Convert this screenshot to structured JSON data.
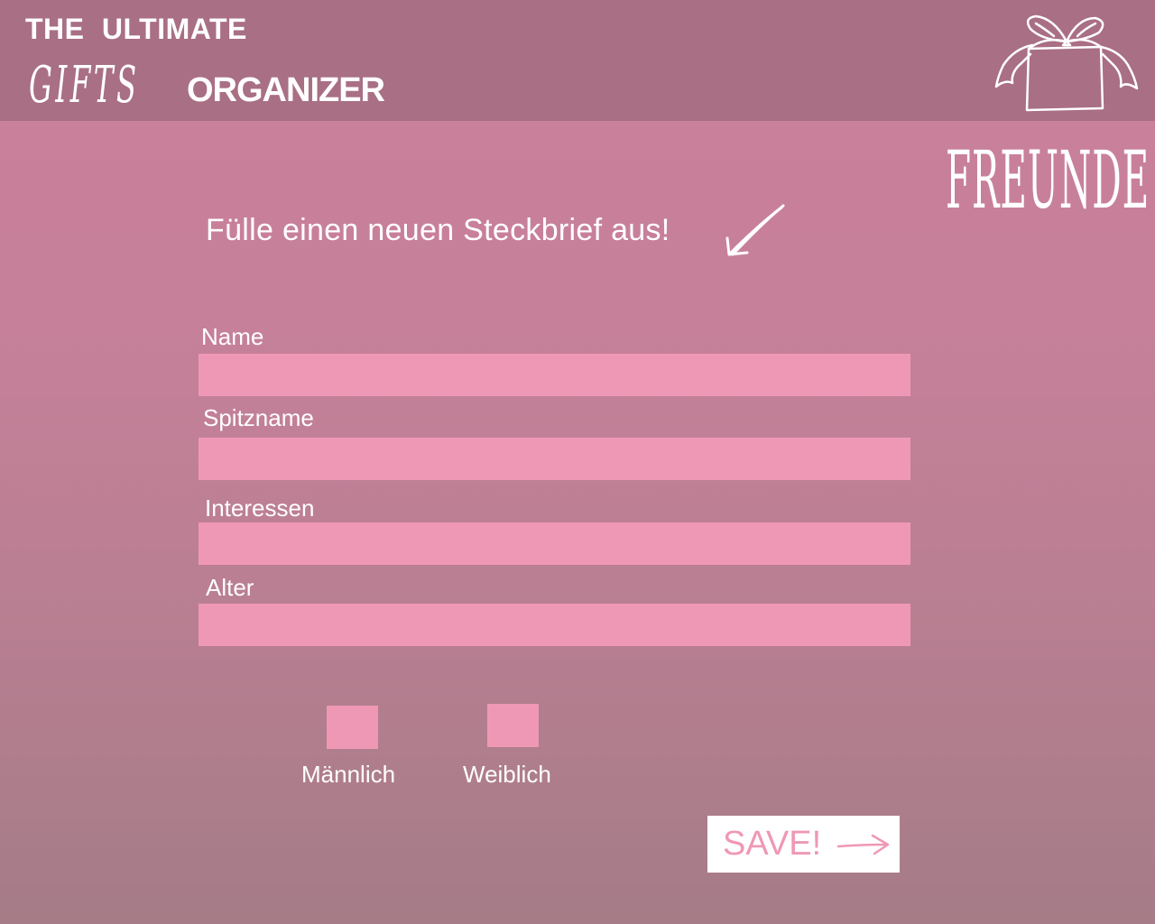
{
  "header": {
    "line1": "THE  ULTIMATE",
    "gifts": "GIFTS",
    "organizer": "ORGANIZER",
    "gift_icon": "gift-box-icon"
  },
  "section_title": "FREUNDE",
  "intro": {
    "text": "Fülle einen neuen Steckbrief aus!",
    "icon": "arrow-down-left-icon"
  },
  "form": {
    "fields": [
      {
        "label": "Name",
        "value": "",
        "placeholder": ""
      },
      {
        "label": "Spitzname",
        "value": "",
        "placeholder": ""
      },
      {
        "label": "Interessen",
        "value": "",
        "placeholder": ""
      },
      {
        "label": "Alter",
        "value": "",
        "placeholder": ""
      }
    ],
    "gender": [
      {
        "label": "Männlich",
        "checked": false
      },
      {
        "label": "Weiblich",
        "checked": false
      }
    ],
    "save_label": "SAVE!",
    "save_icon": "arrow-right-icon"
  },
  "colors": {
    "header_bg": "#a96f84",
    "page_bg_top": "#cb8099",
    "page_bg_bottom": "#a57c87",
    "input_bg": "#ef98b5",
    "text": "#ffffff",
    "button_text": "#ef98b5"
  }
}
